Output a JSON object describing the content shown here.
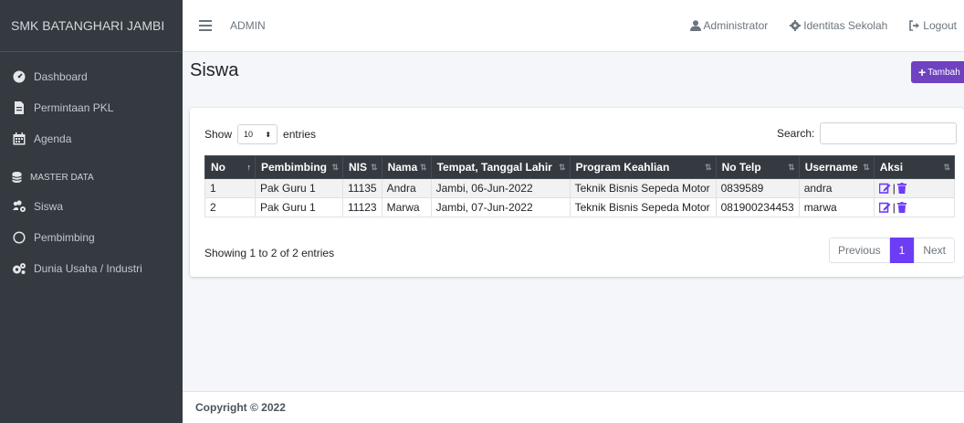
{
  "sidebar": {
    "brand": "SMK BATANGHARI JAMBI",
    "items": [
      {
        "label": "Dashboard",
        "icon": "tachometer-icon"
      },
      {
        "label": "Permintaan PKL",
        "icon": "file-icon"
      },
      {
        "label": "Agenda",
        "icon": "calendar-icon"
      }
    ],
    "section_header": "MASTER DATA",
    "master_items": [
      {
        "label": "Siswa",
        "icon": "users-cog-icon"
      },
      {
        "label": "Pembimbing",
        "icon": "circle-icon"
      },
      {
        "label": "Dunia Usaha / Industri",
        "icon": "cogs-icon"
      }
    ]
  },
  "topbar": {
    "admin": "ADMIN",
    "user": "Administrator",
    "school": "Identitas Sekolah",
    "logout": "Logout"
  },
  "page": {
    "title": "Siswa",
    "add_button": "Tambah",
    "accent": "#6c3df4"
  },
  "table_controls": {
    "show_label": "Show",
    "show_value": "10",
    "entries_label": "entries",
    "search_label": "Search:",
    "info": "Showing 1 to 2 of 2 entries",
    "previous": "Previous",
    "page": "1",
    "next": "Next"
  },
  "table": {
    "headers": [
      "No",
      "Pembimbing",
      "NIS",
      "Nama",
      "Tempat, Tanggal Lahir",
      "Program Keahlian",
      "No Telp",
      "Username",
      "Aksi"
    ],
    "rows": [
      [
        "1",
        "Pak Guru 1",
        "11135",
        "Andra",
        "Jambi, 06-Jun-2022",
        "Teknik Bisnis Sepeda Motor",
        "0839589",
        "andra"
      ],
      [
        "2",
        "Pak Guru 1",
        "11123",
        "Marwa",
        "Jambi, 07-Jun-2022",
        "Teknik Bisnis Sepeda Motor",
        "081900234453",
        "marwa"
      ]
    ],
    "action_separator": "|"
  },
  "footer": {
    "copyright": "Copyright © 2022"
  }
}
